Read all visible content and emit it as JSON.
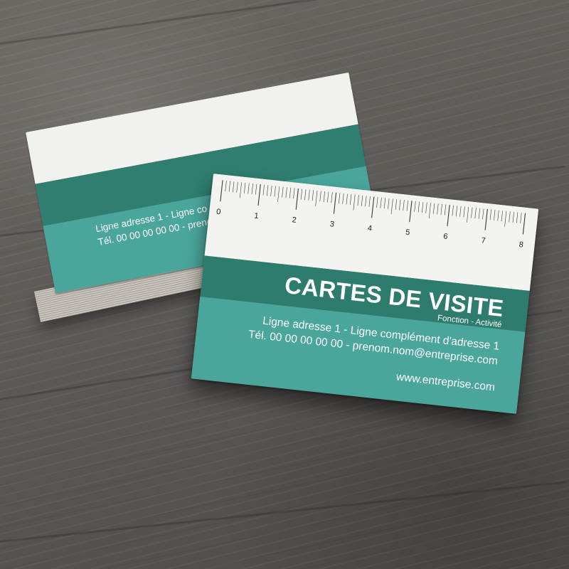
{
  "back_card": {
    "address_line": "Ligne adresse 1 - Ligne co",
    "contact_line": "Tél. 00 00 00 00 00 - prenom"
  },
  "front_card": {
    "ruler_numbers": [
      "0",
      "1",
      "2",
      "3",
      "4",
      "5",
      "6",
      "7",
      "8"
    ],
    "title": "CARTES DE VISITE",
    "function_line": "Fonction - Activité",
    "address_line": "Ligne adresse 1 - Ligne complément d'adresse 1",
    "contact_line": "Tél. 00 00 00 00 00 - prenom.nom@entreprise.com",
    "website": "www.entreprise.com"
  },
  "colors": {
    "card_white": "#f3f3f0",
    "teal_dark": "#2e7c6d",
    "teal_light": "#4aa69b",
    "table_wood": "#5d5a57"
  }
}
